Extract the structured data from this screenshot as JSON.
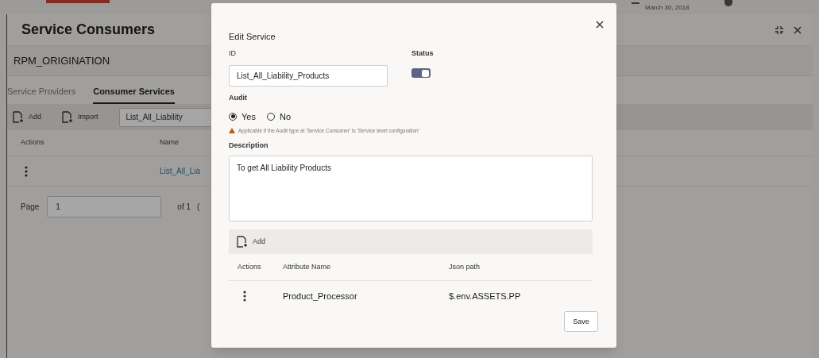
{
  "header": {
    "date": "March 30, 2018"
  },
  "page": {
    "title": "Service Consumers",
    "consumer": "RPM_ORIGINATION",
    "tabs": [
      {
        "label": "Service Providers",
        "selected": false
      },
      {
        "label": "Consumer Services",
        "selected": true
      }
    ],
    "toolbar": {
      "buttons": [
        "Add",
        "Import"
      ],
      "search_value": "List_All_Liability"
    },
    "table": {
      "columns": [
        "Actions",
        "Name"
      ],
      "rows": [
        {
          "name": "List_All_Lia"
        }
      ]
    },
    "pagination": {
      "label": "Page",
      "value": "1",
      "of": "of 1",
      "column_3": "("
    }
  },
  "dialog": {
    "title": "Edit Service",
    "id_label": "ID",
    "id_value": "List_All_Liability_Products",
    "status_label": "Status",
    "status_on": true,
    "audit_label": "Audit",
    "audit_options": [
      {
        "label": "Yes",
        "selected": true
      },
      {
        "label": "No",
        "selected": false
      }
    ],
    "warning": "Applicable if the Audit type at 'Service Consumer' is 'Service level configuration'",
    "description_label": "Description",
    "description_value": "To get All Liability Products",
    "add_button": "Add",
    "attributes": {
      "columns": [
        "Actions",
        "Attribute Name",
        "Json path"
      ],
      "rows": [
        {
          "attribute_name": "Product_Processor",
          "json_path": "$.env.ASSETS.PP"
        }
      ]
    },
    "save_button": "Save"
  }
}
